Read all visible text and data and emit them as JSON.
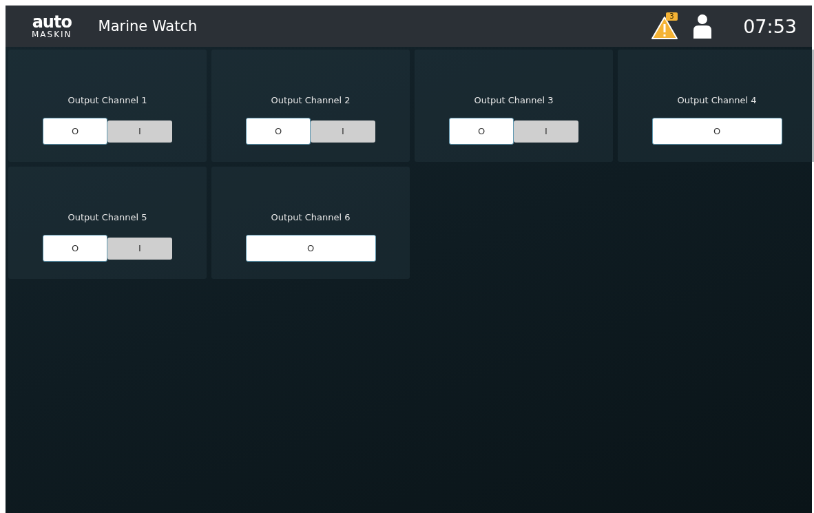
{
  "header": {
    "logo_top": "auto",
    "logo_bottom": "MASKIN",
    "title": "Marine Watch",
    "alarm_count": "3",
    "time": "07:53"
  },
  "channels": [
    {
      "label": "Output Channel 1",
      "kind": "toggle",
      "options": [
        {
          "label": "O",
          "selected": true
        },
        {
          "label": "I",
          "selected": false
        }
      ]
    },
    {
      "label": "Output Channel 2",
      "kind": "toggle",
      "options": [
        {
          "label": "O",
          "selected": true
        },
        {
          "label": "I",
          "selected": false
        }
      ]
    },
    {
      "label": "Output Channel 3",
      "kind": "toggle",
      "options": [
        {
          "label": "O",
          "selected": true
        },
        {
          "label": "I",
          "selected": false
        }
      ]
    },
    {
      "label": "Output Channel 4",
      "kind": "button",
      "options": [
        {
          "label": "O",
          "selected": true
        }
      ]
    },
    {
      "label": "Output Channel 5",
      "kind": "toggle",
      "options": [
        {
          "label": "O",
          "selected": true
        },
        {
          "label": "I",
          "selected": false
        }
      ]
    },
    {
      "label": "Output Channel 6",
      "kind": "button",
      "options": [
        {
          "label": "O",
          "selected": true
        }
      ]
    }
  ]
}
